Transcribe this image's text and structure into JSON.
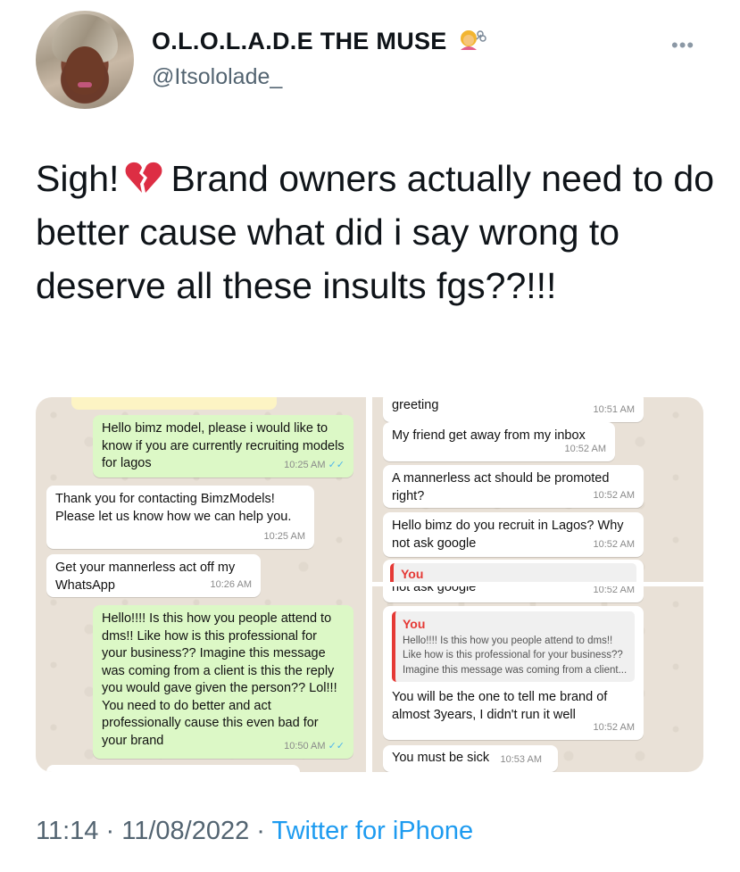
{
  "author": {
    "display_name": "O.L.O.L.A.D.E THE MUSE",
    "handle": "@Itsololade_"
  },
  "more_label": "•••",
  "tweet": {
    "text_before_emoji": "Sigh!",
    "text_after_emoji": "Brand owners actually need to do better cause what did i say wrong to deserve all these insults fgs??!!!"
  },
  "chat_left": [
    {
      "dir": "out",
      "text": "Hello bimz model, please i would like to know if you are currently recruiting models for lagos",
      "time": "10:25 AM",
      "tick": "✓✓"
    },
    {
      "dir": "in",
      "text": "Thank you for contacting BimzModels! Please let us know how we can help you.",
      "time": "10:25 AM"
    },
    {
      "dir": "in",
      "text": "Get your mannerless act off my WhatsApp",
      "time": "10:26 AM"
    },
    {
      "dir": "out",
      "text": "Hello!!!! Is this how you people attend to dms!! Like how is this professional for your business?? Imagine this message was coming from a client is this the reply you would gave given the person?? Lol!!! You need to do better and act professionally cause this even bad for your brand",
      "time": "10:50 AM",
      "tick": "✓✓"
    }
  ],
  "chat_right_top": [
    {
      "dir": "in",
      "text": "greeting",
      "time": "10:51 AM"
    },
    {
      "dir": "in",
      "text": "My friend get away from my inbox",
      "time": "10:52 AM"
    },
    {
      "dir": "in",
      "text": "A mannerless act should be promoted right?",
      "time": "10:52 AM"
    },
    {
      "dir": "in",
      "text": "Hello bimz do you recruit in Lagos? Why not ask google",
      "time": "10:52 AM"
    },
    {
      "dir": "in",
      "quote_name": "You"
    }
  ],
  "chat_right_bottom": [
    {
      "dir": "in",
      "text": "not ask google",
      "time": "10:52 AM"
    },
    {
      "dir": "in",
      "quote_name": "You",
      "quote_text": "Hello!!!! Is this how you people attend to dms!! Like how is this professional for your business?? Imagine this message was coming from a client...",
      "text": "You will be the one to tell me brand of almost 3years, I didn't run it well",
      "time": "10:52 AM"
    },
    {
      "dir": "in",
      "text": "You must be sick",
      "time": "10:53 AM"
    }
  ],
  "footer": {
    "time": "11:14",
    "sep1": "·",
    "date": "11/08/2022",
    "sep2": "·",
    "source": "Twitter for iPhone"
  },
  "colors": {
    "link": "#1d9bf0",
    "muted": "#536471",
    "outgoing_bubble": "#dcf8c6",
    "chat_background": "#e9e1d7",
    "quote_accent": "#e53935"
  },
  "icons": {
    "name_emoji": "woman-getting-haircut-emoji",
    "broken_heart": "broken-heart-emoji",
    "read_receipt": "double-check-icon"
  }
}
